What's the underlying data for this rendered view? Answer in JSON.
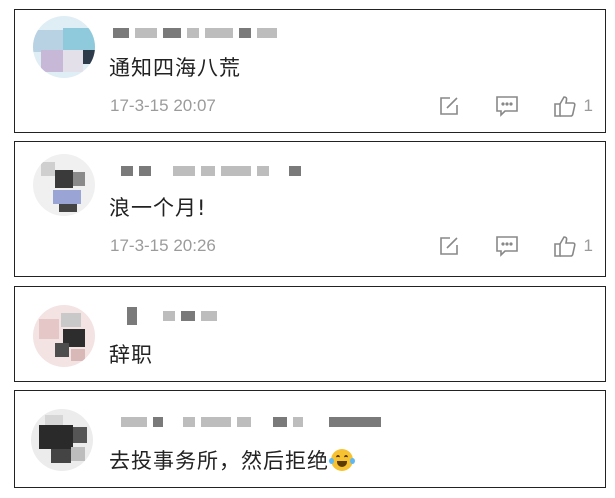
{
  "comments": [
    {
      "text": "通知四海八荒",
      "time": "17-3-15 20:07",
      "likes": "1",
      "icons": [
        "edit-icon",
        "comment-icon",
        "thumbs-up-icon"
      ]
    },
    {
      "text": "浪一个月!",
      "time": "17-3-15 20:26",
      "likes": "1",
      "icons": [
        "edit-icon",
        "comment-icon",
        "thumbs-up-icon"
      ]
    },
    {
      "text": "辞职"
    },
    {
      "text": "去投事务所，然后拒绝",
      "emoji": "laughing-tears-icon"
    }
  ],
  "colors": {
    "border": "#222222",
    "meta": "#9b9b9b",
    "text": "#222222"
  }
}
